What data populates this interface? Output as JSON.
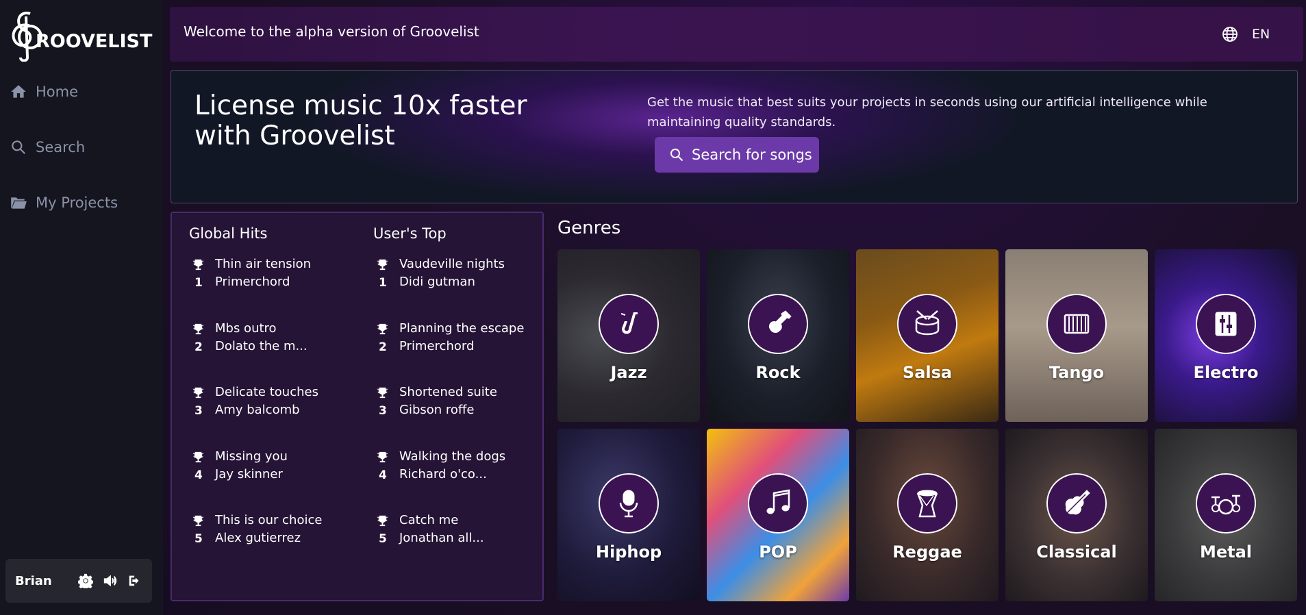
{
  "app": {
    "name": "ROOVELIST"
  },
  "sidebar": {
    "items": [
      {
        "label": "Home",
        "icon": "home-icon"
      },
      {
        "label": "Search",
        "icon": "search-icon"
      },
      {
        "label": "My Projects",
        "icon": "folder-icon"
      }
    ],
    "user": {
      "name": "Brian"
    }
  },
  "topbar": {
    "welcome": "Welcome to the alpha version of Groovelist",
    "language": "EN"
  },
  "hero": {
    "title": "License music 10x faster with Groovelist",
    "description": "Get the music that best suits your projects in seconds using our artificial intelligence while maintaining quality standards.",
    "button_label": "Search for songs"
  },
  "charts": {
    "global": {
      "title": "Global Hits",
      "items": [
        {
          "rank": "1",
          "song": "Thin air tension",
          "artist": "Primerchord"
        },
        {
          "rank": "2",
          "song": "Mbs outro",
          "artist": "Dolato the m..."
        },
        {
          "rank": "3",
          "song": "Delicate touches",
          "artist": "Amy balcomb"
        },
        {
          "rank": "4",
          "song": "Missing you",
          "artist": "Jay skinner"
        },
        {
          "rank": "5",
          "song": "This is our choice",
          "artist": "Alex gutierrez"
        }
      ]
    },
    "users": {
      "title": "User's Top",
      "items": [
        {
          "rank": "1",
          "song": "Vaudeville nights",
          "artist": "Didi gutman"
        },
        {
          "rank": "2",
          "song": "Planning the escape",
          "artist": "Primerchord"
        },
        {
          "rank": "3",
          "song": "Shortened suite",
          "artist": "Gibson roffe"
        },
        {
          "rank": "4",
          "song": "Walking the dogs",
          "artist": "Richard o'co..."
        },
        {
          "rank": "5",
          "song": "Catch me",
          "artist": "Jonathan all..."
        }
      ]
    }
  },
  "genres": {
    "title": "Genres",
    "items": [
      {
        "name": "Jazz",
        "icon": "saxophone-icon"
      },
      {
        "name": "Rock",
        "icon": "guitar-icon"
      },
      {
        "name": "Salsa",
        "icon": "drum-icon"
      },
      {
        "name": "Tango",
        "icon": "accordion-icon"
      },
      {
        "name": "Electro",
        "icon": "mixer-icon"
      },
      {
        "name": "Hiphop",
        "icon": "microphone-icon"
      },
      {
        "name": "POP",
        "icon": "music-notes-icon"
      },
      {
        "name": "Reggae",
        "icon": "djembe-icon"
      },
      {
        "name": "Classical",
        "icon": "violin-icon"
      },
      {
        "name": "Metal",
        "icon": "drum-kit-icon"
      }
    ]
  },
  "colors": {
    "sidebar_bg": "#15151f",
    "accent": "#6c3aa8",
    "panel_border": "#4a2a6d"
  }
}
